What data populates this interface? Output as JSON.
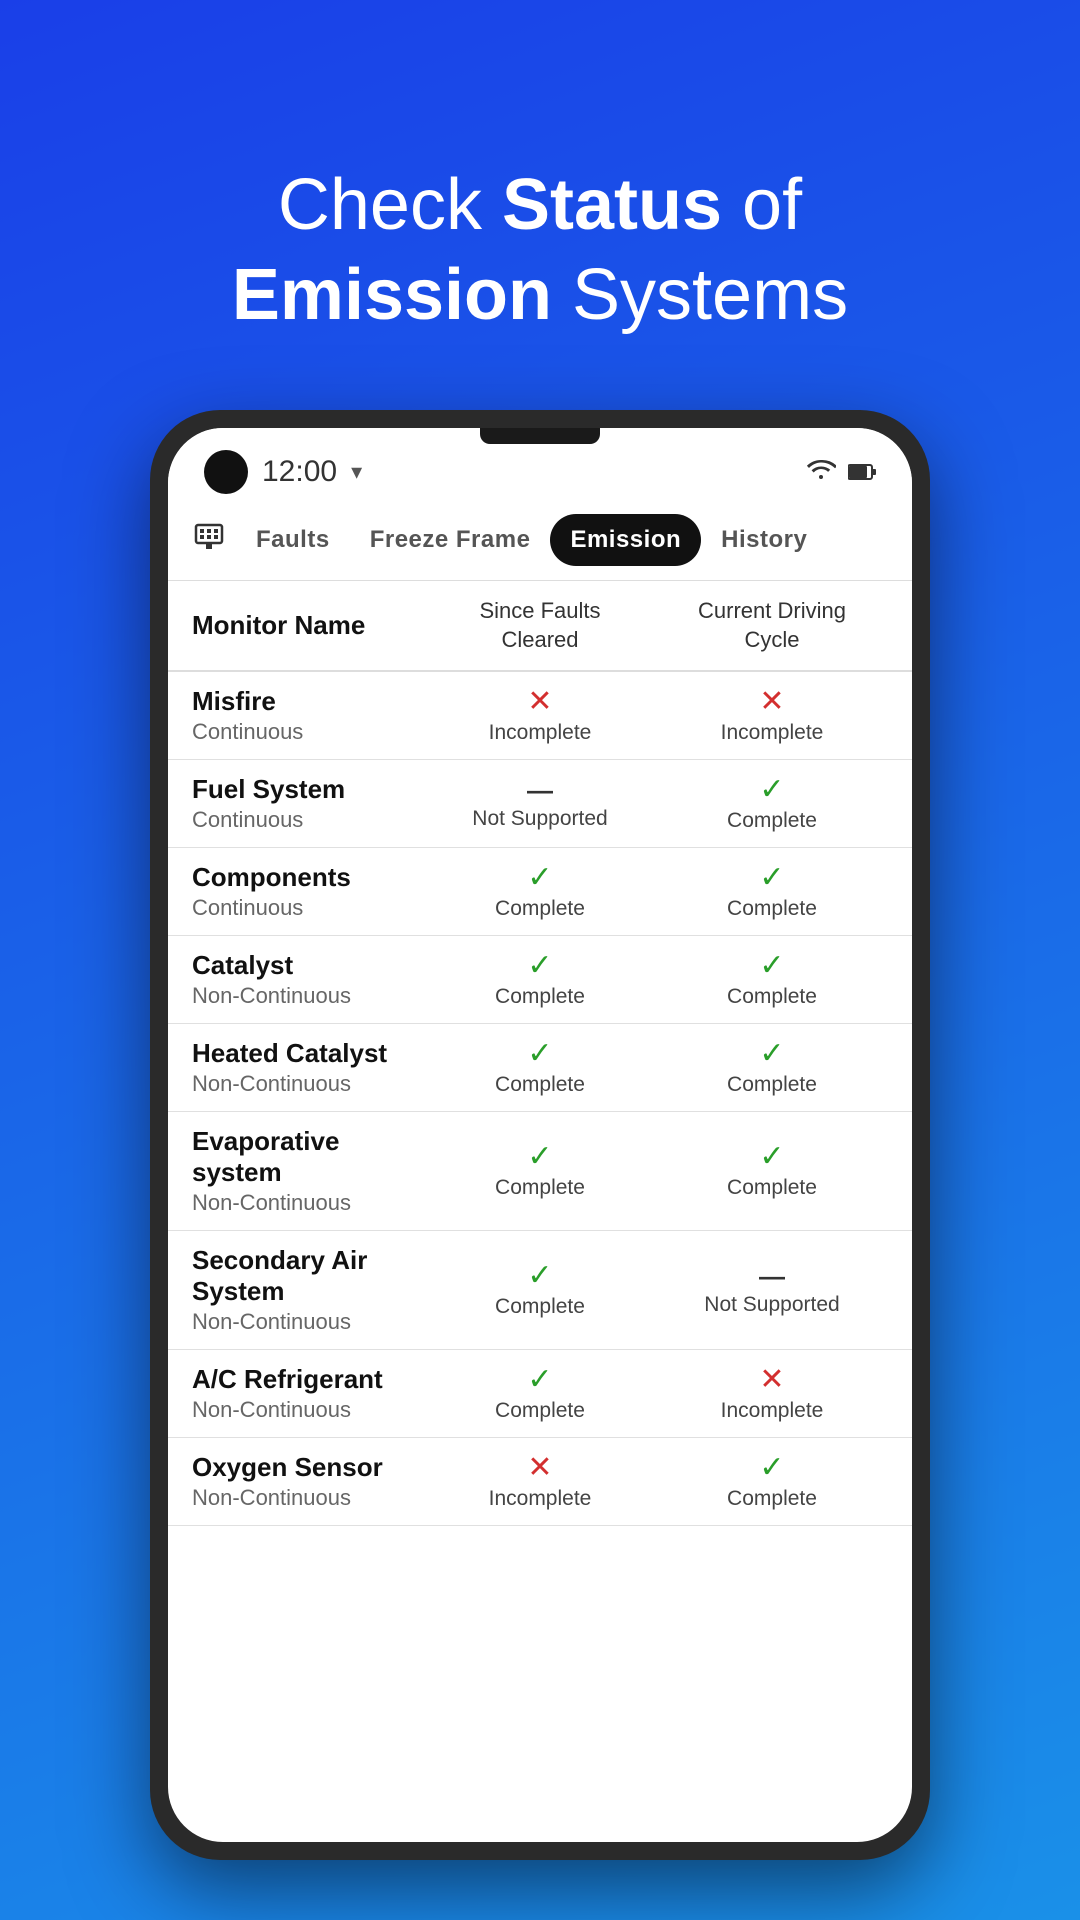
{
  "hero": {
    "line1": "Check ",
    "line1_bold": "Status",
    "line1_end": " of",
    "line2_bold": "Emission",
    "line2_end": " Systems"
  },
  "statusBar": {
    "time": "12:00",
    "wifi": "▾",
    "battery": "▮"
  },
  "tabs": [
    {
      "id": "faults",
      "label": "Faults",
      "active": false
    },
    {
      "id": "freeze-frame",
      "label": "Freeze Frame",
      "active": false
    },
    {
      "id": "emission",
      "label": "Emission",
      "active": true
    },
    {
      "id": "history",
      "label": "History",
      "active": false
    }
  ],
  "tableHeader": {
    "col1": "Monitor Name",
    "col2": "Since Faults Cleared",
    "col3": "Current Driving Cycle"
  },
  "rows": [
    {
      "name": "Misfire",
      "type": "Continuous",
      "sinceCleared": {
        "type": "incomplete",
        "label": "Incomplete"
      },
      "currentCycle": {
        "type": "incomplete",
        "label": "Incomplete"
      }
    },
    {
      "name": "Fuel System",
      "type": "Continuous",
      "sinceCleared": {
        "type": "not-supported",
        "label": "Not Supported"
      },
      "currentCycle": {
        "type": "complete",
        "label": "Complete"
      }
    },
    {
      "name": "Components",
      "type": "Continuous",
      "sinceCleared": {
        "type": "complete",
        "label": "Complete"
      },
      "currentCycle": {
        "type": "complete",
        "label": "Complete"
      }
    },
    {
      "name": "Catalyst",
      "type": "Non-Continuous",
      "sinceCleared": {
        "type": "complete",
        "label": "Complete"
      },
      "currentCycle": {
        "type": "complete",
        "label": "Complete"
      }
    },
    {
      "name": "Heated Catalyst",
      "type": "Non-Continuous",
      "sinceCleared": {
        "type": "complete",
        "label": "Complete"
      },
      "currentCycle": {
        "type": "complete",
        "label": "Complete"
      }
    },
    {
      "name": "Evaporative system",
      "type": "Non-Continuous",
      "sinceCleared": {
        "type": "complete",
        "label": "Complete"
      },
      "currentCycle": {
        "type": "complete",
        "label": "Complete"
      }
    },
    {
      "name": "Secondary Air System",
      "type": "Non-Continuous",
      "sinceCleared": {
        "type": "complete",
        "label": "Complete"
      },
      "currentCycle": {
        "type": "not-supported",
        "label": "Not Supported"
      }
    },
    {
      "name": "A/C Refrigerant",
      "type": "Non-Continuous",
      "sinceCleared": {
        "type": "complete",
        "label": "Complete"
      },
      "currentCycle": {
        "type": "incomplete",
        "label": "Incomplete"
      }
    },
    {
      "name": "Oxygen Sensor",
      "type": "Non-Continuous",
      "sinceCleared": {
        "type": "incomplete",
        "label": "Incomplete"
      },
      "currentCycle": {
        "type": "complete",
        "label": "Complete"
      }
    }
  ]
}
